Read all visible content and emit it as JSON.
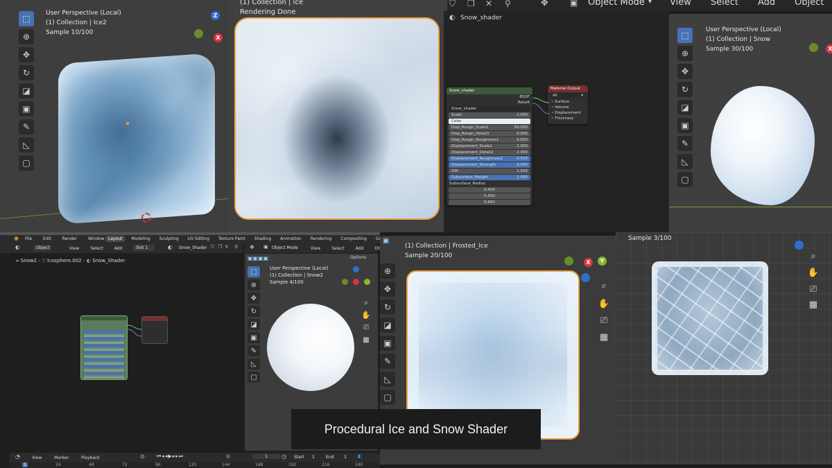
{
  "top_menu": {
    "object_mode": "Object Mode",
    "items": [
      "View",
      "Select",
      "Add",
      "Object"
    ]
  },
  "vp_ice2": {
    "line1": "User Perspective (Local)",
    "line2": "(1) Collection | Ice2",
    "line3": "Sample 10/100"
  },
  "vp_render": {
    "line1": "(1) Collection | Ice",
    "line2": "Rendering Done"
  },
  "shader_editor_top": {
    "material_name": "Snow_shader",
    "group_node": {
      "title": "Snow_shader",
      "out_bsdf": "BSDF",
      "out_result": "Result",
      "field": "Snow_shader",
      "rows": [
        {
          "label": "Scale",
          "value": "1.000",
          "style": "gray"
        },
        {
          "label": "Color",
          "value": "",
          "style": "color"
        },
        {
          "label": "Disp_Rough_Scale1",
          "value": "50.000",
          "style": "gray"
        },
        {
          "label": "Disp_Rough_Detail1",
          "value": "0.000",
          "style": "gray"
        },
        {
          "label": "Disp_Rough_Roughness1",
          "value": "0.650",
          "style": "gray"
        },
        {
          "label": "Displacement_Scale1",
          "value": "1.000",
          "style": "gray"
        },
        {
          "label": "Displacement_Detail2",
          "value": "2.000",
          "style": "gray"
        },
        {
          "label": "Displacement_Roughness2",
          "value": "0.500",
          "style": "blue"
        },
        {
          "label": "Displacement_Strength",
          "value": "0.030",
          "style": "blue"
        },
        {
          "label": "IOR",
          "value": "1.500",
          "style": "gray"
        },
        {
          "label": "Subsurface_Weight",
          "value": "1.000",
          "style": "blue"
        }
      ],
      "radius_label": "Subsurface_Radius",
      "radius_values": [
        "0.400",
        "0.500",
        "0.600"
      ]
    },
    "output_node": {
      "title": "Material Output",
      "target": "All",
      "sockets": [
        "Surface",
        "Volume",
        "Displacement",
        "Thickness"
      ]
    }
  },
  "vp_snow": {
    "line1": "User Perspective (Local)",
    "line2": "(1) Collection | Snow",
    "line3": "Sample 30/100"
  },
  "blender_ui": {
    "file_menu": [
      "File",
      "Edit",
      "Render",
      "Window",
      "Help"
    ],
    "workspace_tabs": [
      "Layout",
      "Modeling",
      "Sculpting",
      "UV Editing",
      "Texture Paint",
      "Shading",
      "Animation",
      "Rendering",
      "Compositing",
      "Geome"
    ],
    "active_tab": "Layout",
    "node_header": {
      "object_dropdown": "Object",
      "items": [
        "View",
        "Select",
        "Add",
        "Node"
      ],
      "slot": "Slot 1",
      "material": "Snow_Shader"
    },
    "breadcrumb": [
      "Snow2",
      "Icosphere.002",
      "Snow_Shader"
    ],
    "vp3d_header": {
      "mode": "Object Mode",
      "items": [
        "View",
        "Select",
        "Add",
        "Object"
      ],
      "options": "Options"
    },
    "vp_snow2": {
      "line1": "User Perspective (Local)",
      "line2": "(1) Collection | Snow2",
      "line3": "Sample 4/100"
    },
    "timeline": {
      "items": [
        "View",
        "Marker",
        "Playback"
      ],
      "current_frame": "1",
      "start_label": "Start",
      "start": "1",
      "end_label": "End",
      "end": "1",
      "ruler": [
        "1",
        "24",
        "48",
        "72",
        "96",
        "120",
        "144",
        "168",
        "192",
        "216",
        "240"
      ]
    }
  },
  "vp_frosted": {
    "line1": "(1) Collection | Frosted_Ice",
    "line2": "Sample 20/100"
  },
  "vp_cracked": {
    "line1": "Sample 3/100"
  },
  "caption": "Procedural Ice and Snow Shader"
}
